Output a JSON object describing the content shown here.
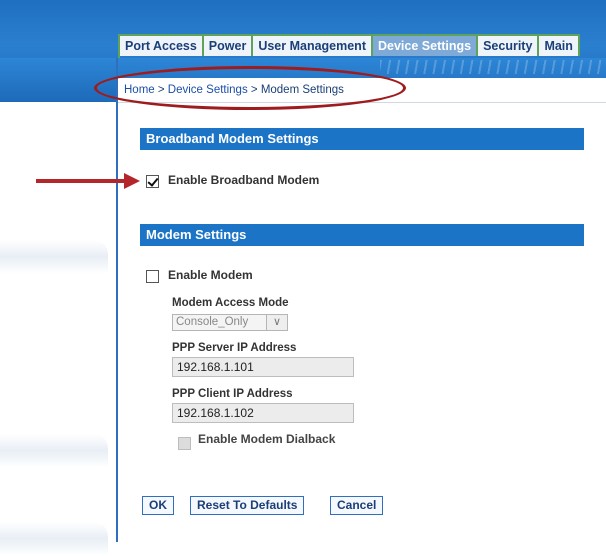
{
  "tabs": [
    {
      "label": "Port Access",
      "active": false
    },
    {
      "label": "Power",
      "active": false
    },
    {
      "label": "User Management",
      "active": false
    },
    {
      "label": "Device Settings",
      "active": true
    },
    {
      "label": "Security",
      "active": false
    },
    {
      "label": "Main",
      "active": false
    }
  ],
  "breadcrumb": {
    "home": "Home",
    "sep1": " > ",
    "device_settings": "Device Settings",
    "sep2": " > ",
    "current": "Modem Settings"
  },
  "broadband": {
    "header": "Broadband Modem Settings",
    "enable_label": "Enable Broadband Modem",
    "enable_checked": true
  },
  "modem": {
    "header": "Modem Settings",
    "enable_label": "Enable Modem",
    "enable_checked": false,
    "access_mode_label": "Modem Access Mode",
    "access_mode_value": "Console_Only",
    "ppp_server_label": "PPP Server IP Address",
    "ppp_server_value": "192.168.1.101",
    "ppp_client_label": "PPP Client IP Address",
    "ppp_client_value": "192.168.1.102",
    "dialback_label": "Enable Modem Dialback",
    "dialback_checked": false
  },
  "buttons": {
    "ok": "OK",
    "reset": "Reset To Defaults",
    "cancel": "Cancel"
  },
  "colors": {
    "header_blue": "#1c74c7",
    "tab_border_green": "#5fa35a",
    "annotation_red": "#b3262a"
  }
}
